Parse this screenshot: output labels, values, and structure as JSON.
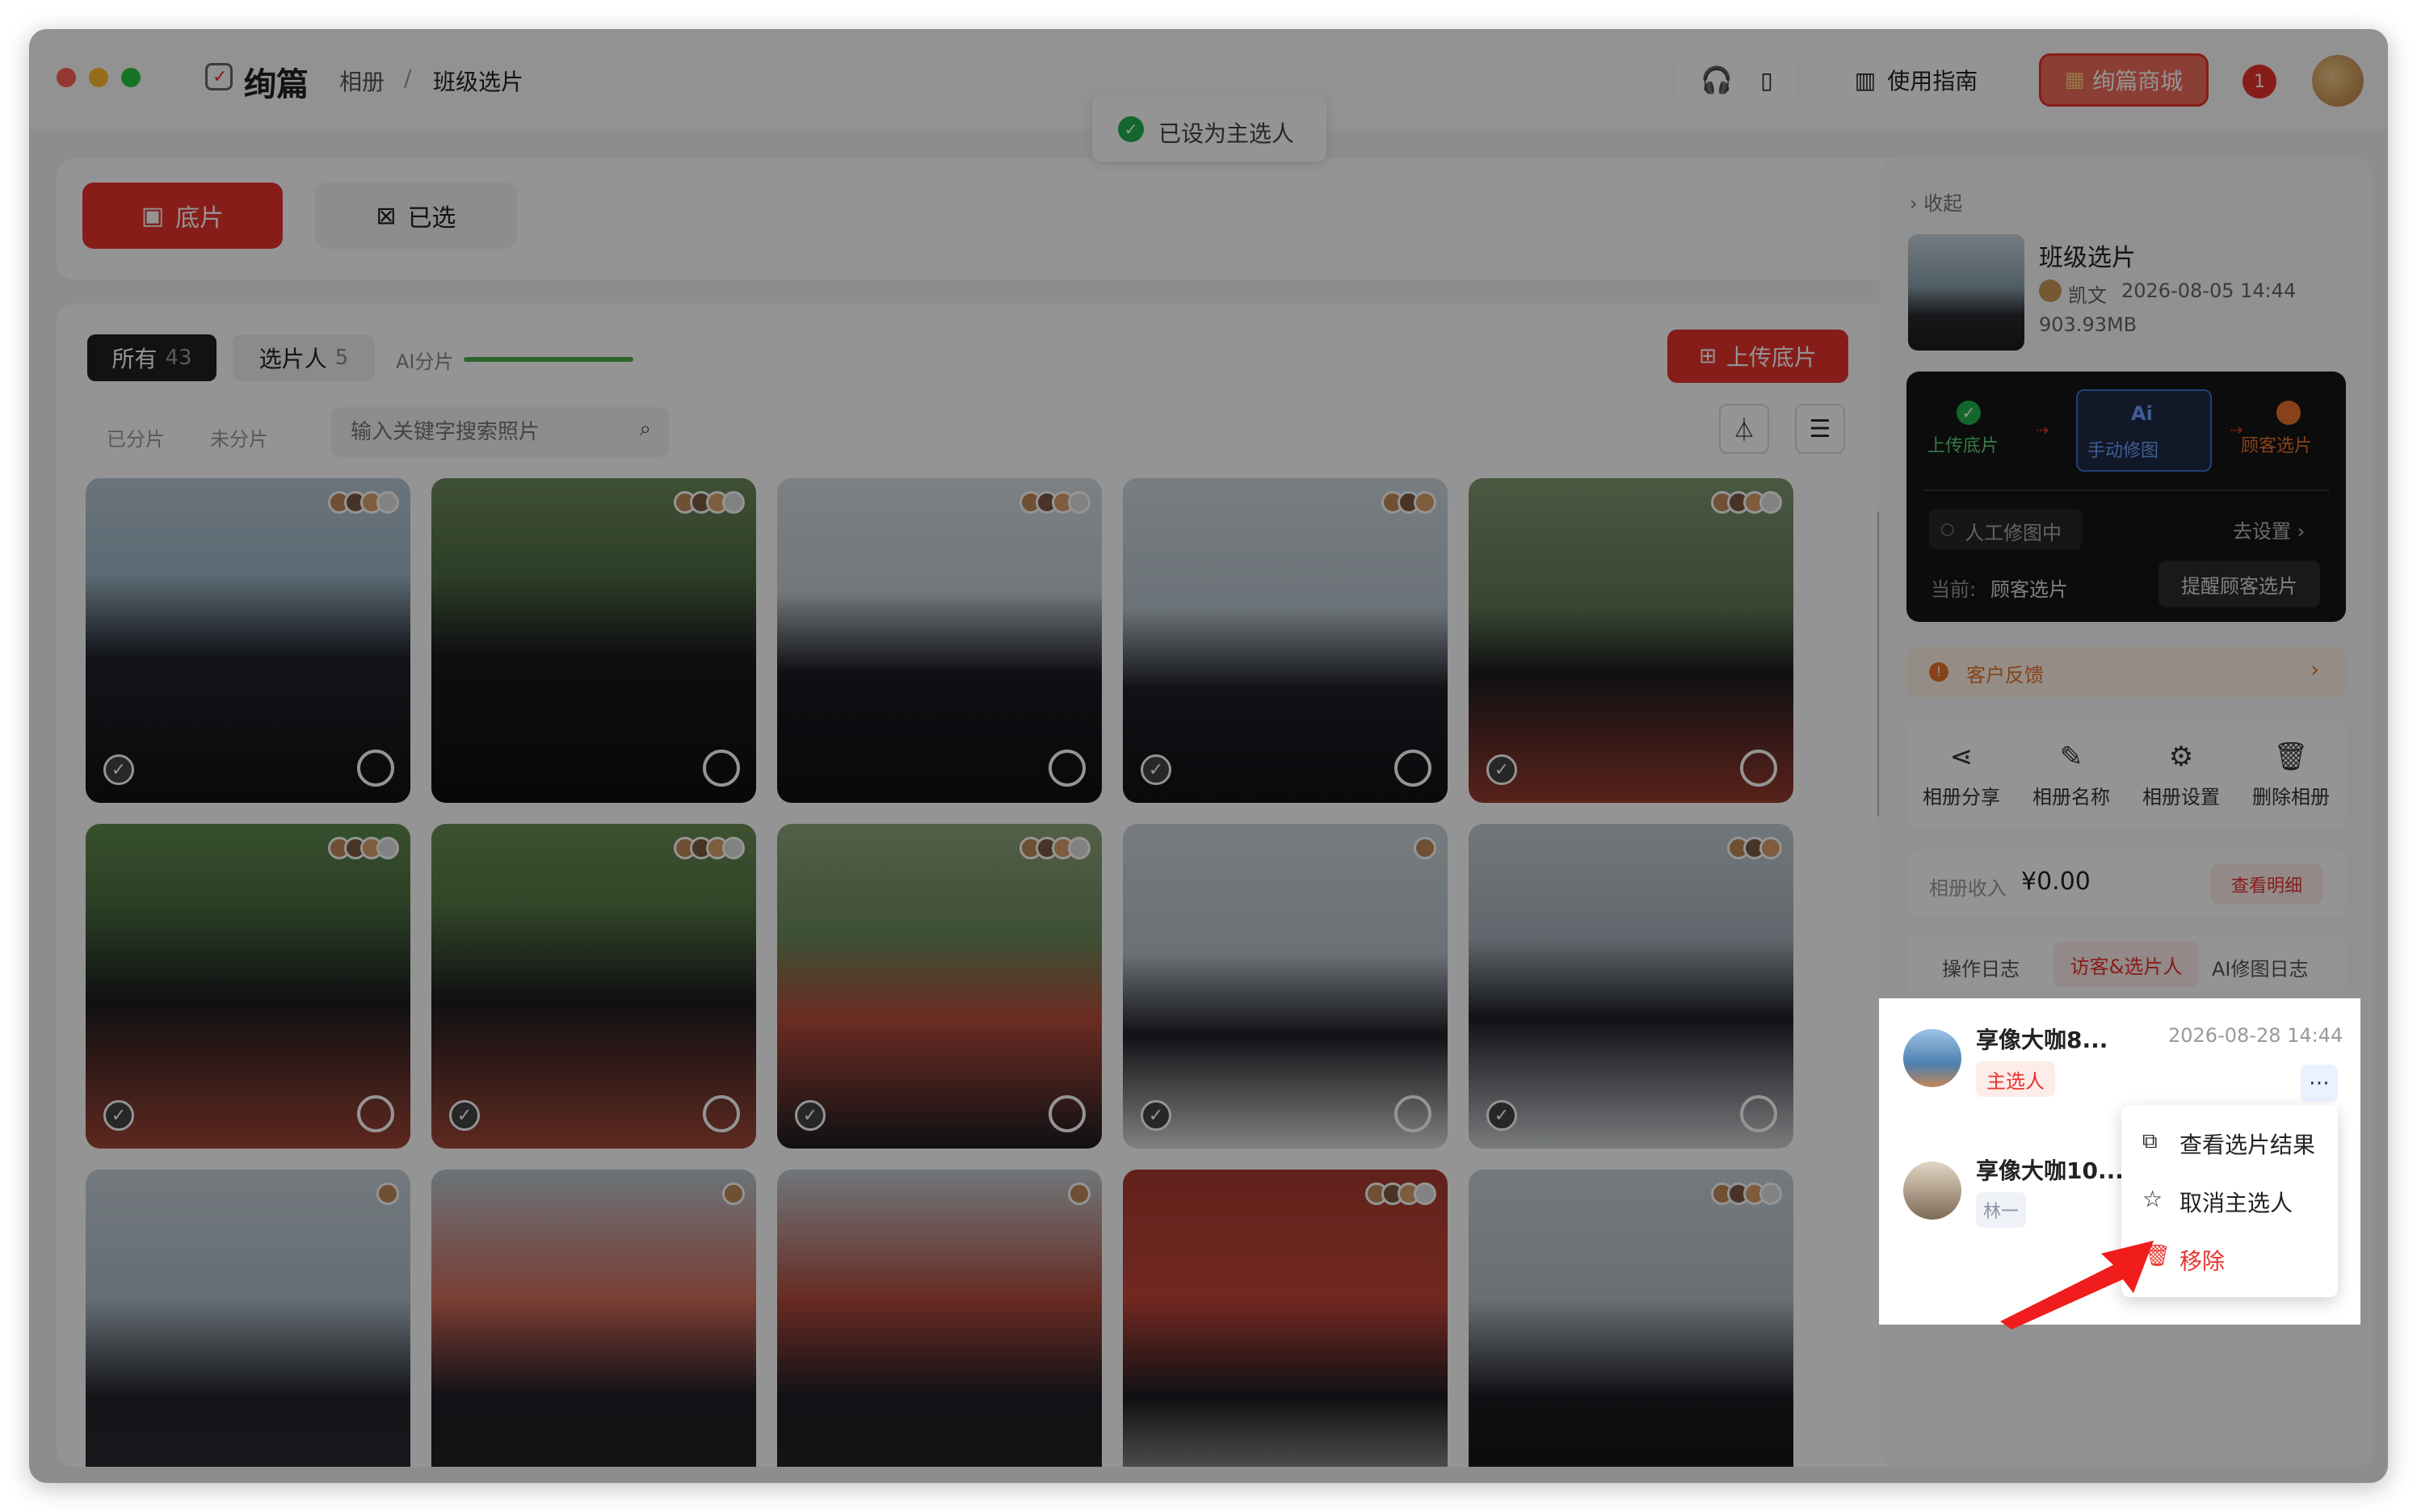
{
  "app": {
    "logo_text": "绚篇",
    "breadcrumb_album": "相册",
    "breadcrumb_sep": "/",
    "breadcrumb_current": "班级选片"
  },
  "header": {
    "guide_label": "使用指南",
    "shop_label": "绚篇商城",
    "badge_count": "1"
  },
  "toast": {
    "text": "已设为主选人"
  },
  "tabs": {
    "raw_label": "底片",
    "selected_label": "已选"
  },
  "filters": {
    "all_label": "所有",
    "all_count": "43",
    "selector_label": "选片人",
    "selector_count": "5",
    "ai_label": "AI分片",
    "sorted_label": "已分片",
    "unsorted_label": "未分片",
    "search_placeholder": "输入关键字搜索照片",
    "upload_label": "上传底片"
  },
  "album": {
    "collapse_label": "收起",
    "title": "班级选片",
    "owner": "凯文",
    "created": "2026-08-05 14:44",
    "size": "903.93MB"
  },
  "workflow": {
    "step1": "上传底片",
    "step2": "手动修图",
    "step3": "顾客选片",
    "retouch_status": "人工修图中",
    "go_settings": "去设置",
    "current_label": "当前:",
    "current_value": "顾客选片",
    "remind_button": "提醒顾客选片"
  },
  "feedback": {
    "label": "客户反馈"
  },
  "actions": [
    {
      "label": "相册分享",
      "icon": "share-icon"
    },
    {
      "label": "相册名称",
      "icon": "edit-icon"
    },
    {
      "label": "相册设置",
      "icon": "gear-icon"
    },
    {
      "label": "删除相册",
      "icon": "trash-icon"
    }
  ],
  "income": {
    "label": "相册收入",
    "value": "¥0.00",
    "detail_label": "查看明细"
  },
  "log_tabs": {
    "op_log": "操作日志",
    "visitors": "访客&选片人",
    "ai_log": "AI修图日志"
  },
  "visitors": [
    {
      "name": "享像大咖8...",
      "time": "2026-08-28 14:44",
      "tag": "主选人"
    },
    {
      "name": "享像大咖10...",
      "tag": "林一"
    }
  ],
  "menu": {
    "view_result": "查看选片结果",
    "cancel_main": "取消主选人",
    "remove": "移除"
  },
  "colors": {
    "accent": "#e8322b",
    "success": "#22b14c",
    "dark_panel": "#1a1a1a"
  }
}
